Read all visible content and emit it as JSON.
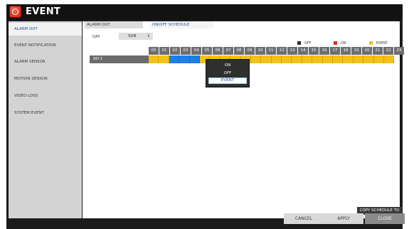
{
  "app": {
    "title": "EVENT",
    "logo_icon": "record-icon",
    "accent": "#d8281a"
  },
  "sidebar": {
    "items": [
      {
        "label": "ALARM OUT",
        "active": true
      },
      {
        "label": "EVENT NOTIFICATION",
        "active": false
      },
      {
        "label": "ALARM SENSOR",
        "active": false
      },
      {
        "label": "MOTION SENSOR",
        "active": false
      },
      {
        "label": "VIDEO LOSS",
        "active": false
      },
      {
        "label": "SYSTEM EVENT",
        "active": false
      }
    ]
  },
  "main": {
    "header_label": "ALARM OUT",
    "tab": "ON/OFF SCHEDULE",
    "day_label": "DAY",
    "day_value": "SUN",
    "legend": [
      {
        "label": "OFF",
        "color": "#2d2d2d"
      },
      {
        "label": "ON",
        "color": "#e8281a"
      },
      {
        "label": "EVENT",
        "color": "#f2c218"
      }
    ],
    "hours": [
      "00",
      "01",
      "02",
      "03",
      "04",
      "05",
      "06",
      "07",
      "08",
      "09",
      "10",
      "11",
      "12",
      "13",
      "14",
      "15",
      "16",
      "17",
      "18",
      "19",
      "20",
      "21",
      "22",
      "23"
    ],
    "alarm_row": {
      "label": "AO 1"
    },
    "schedule_colors": {
      "event": "#f2c218",
      "selected": "#1e7fe6"
    },
    "popup_options": [
      "ON",
      "OFF",
      "EVENT"
    ],
    "popup_selected": "EVENT",
    "copy_button": "COPY SCHEDULE TO"
  },
  "footer": {
    "cancel": "CANCEL",
    "apply": "APPLY",
    "close": "CLOSE"
  }
}
